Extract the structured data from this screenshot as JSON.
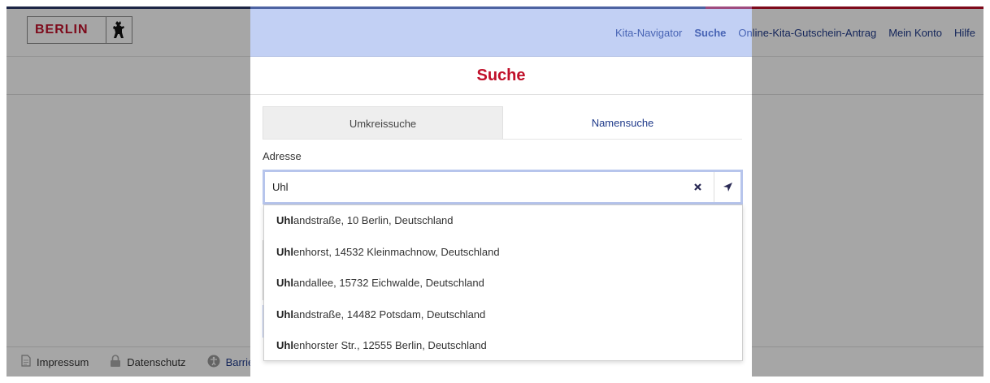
{
  "header": {
    "logo_text": "BERLIN",
    "nav": [
      {
        "label": "Kita-Navigator",
        "active": false
      },
      {
        "label": "Suche",
        "active": true
      },
      {
        "label": "Online-Kita-Gutschein-Antrag",
        "active": false
      },
      {
        "label": "Mein Konto",
        "active": false
      },
      {
        "label": "Hilfe",
        "active": false
      }
    ]
  },
  "panel": {
    "title": "Suche",
    "tabs": [
      {
        "label": "Umkreissuche",
        "active": false
      },
      {
        "label": "Namensuche",
        "active": true
      }
    ],
    "address_label": "Adresse",
    "search_value": "Uhl",
    "suggestions": [
      {
        "match": "Uhl",
        "rest": "andstraße, 10 Berlin, Deutschland"
      },
      {
        "match": "Uhl",
        "rest": "enhorst, 14532 Kleinmachnow, Deutschland"
      },
      {
        "match": "Uhl",
        "rest": "andallee, 15732 Eichwalde, Deutschland"
      },
      {
        "match": "Uhl",
        "rest": "andstraße, 14482 Potsdam, Deutschland"
      },
      {
        "match": "Uhl",
        "rest": "enhorster Str., 12555 Berlin, Deutschland"
      }
    ]
  },
  "footer": {
    "impressum": "Impressum",
    "datenschutz": "Datenschutz",
    "barrierefreiheit": "Barrierefreiheitserklärung"
  },
  "icons": {
    "clear": "close-icon",
    "locate": "location-arrow-icon"
  },
  "colors": {
    "brand_red": "#c0102a",
    "link_blue": "#1f3a8a"
  }
}
